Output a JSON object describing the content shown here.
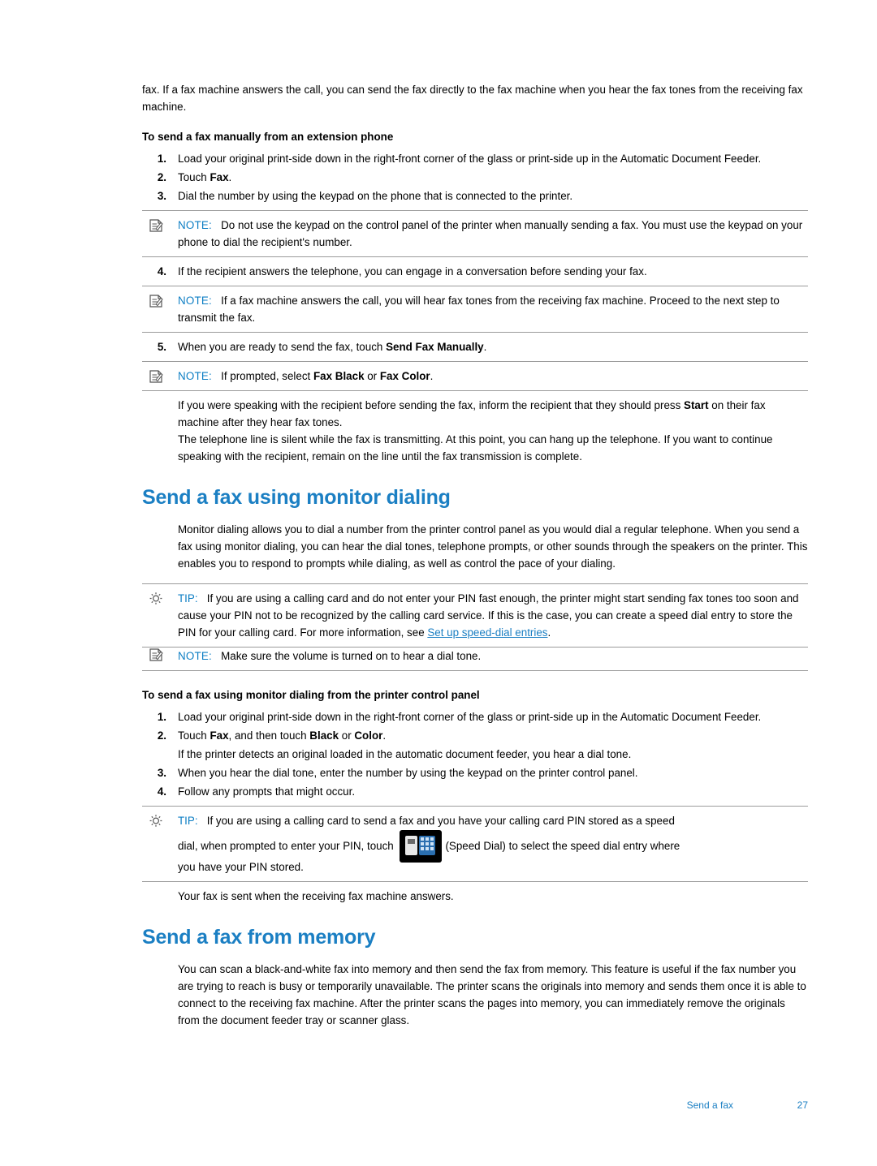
{
  "intro": {
    "line": "fax. If a fax machine answers the call, you can send the fax directly to the fax machine when you hear the fax tones from the receiving fax machine."
  },
  "section1": {
    "heading": "To send a fax manually from an extension phone",
    "steps": [
      {
        "num": "1.",
        "text": "Load your original print-side down in the right-front corner of the glass or print-side up in the Automatic Document Feeder."
      },
      {
        "num": "2.",
        "pre": "Touch ",
        "bold": "Fax",
        "post": "."
      },
      {
        "num": "3.",
        "text": "Dial the number by using the keypad on the phone that is connected to the printer."
      },
      {
        "num": "4.",
        "text": "If the recipient answers the telephone, you can engage in a conversation before sending your fax."
      },
      {
        "num": "5.",
        "pre": "When you are ready to send the fax, touch ",
        "bold": "Send Fax Manually",
        "post": "."
      }
    ],
    "note1": {
      "label": "NOTE:",
      "text": "Do not use the keypad on the control panel of the printer when manually sending a fax. You must use the keypad on your phone to dial the recipient's number."
    },
    "note2": {
      "label": "NOTE:",
      "text": "If a fax machine answers the call, you will hear fax tones from the receiving fax machine. Proceed to the next step to transmit the fax."
    },
    "note3": {
      "label": "NOTE:",
      "pre": "If prompted, select ",
      "bold1": "Fax Black",
      "mid": " or ",
      "bold2": "Fax Color",
      "post": "."
    },
    "after1_pre": "If you were speaking with the recipient before sending the fax, inform the recipient that they should press ",
    "after1_bold": "Start",
    "after1_post": " on their fax machine after they hear fax tones.",
    "after2": "The telephone line is silent while the fax is transmitting. At this point, you can hang up the telephone. If you want to continue speaking with the recipient, remain on the line until the fax transmission is complete."
  },
  "section2": {
    "heading": "Send a fax using monitor dialing",
    "intro": "Monitor dialing allows you to dial a number from the printer control panel as you would dial a regular telephone. When you send a fax using monitor dialing, you can hear the dial tones, telephone prompts, or other sounds through the speakers on the printer. This enables you to respond to prompts while dialing, as well as control the pace of your dialing.",
    "tip1": {
      "label": "TIP:",
      "text_pre": "If you are using a calling card and do not enter your PIN fast enough, the printer might start sending fax tones too soon and cause your PIN not to be recognized by the calling card service. If this is the case, you can create a speed dial entry to store the PIN for your calling card. For more information, see ",
      "link": "Set up speed-dial entries",
      "text_post": "."
    },
    "note1": {
      "label": "NOTE:",
      "text": "Make sure the volume is turned on to hear a dial tone."
    },
    "sub_heading": "To send a fax using monitor dialing from the printer control panel",
    "steps": [
      {
        "num": "1.",
        "text": "Load your original print-side down in the right-front corner of the glass or print-side up in the Automatic Document Feeder."
      },
      {
        "num": "2.",
        "pre": "Touch ",
        "bold1": "Fax",
        "mid": ", and then touch ",
        "bold2": "Black",
        "mid2": " or ",
        "bold3": "Color",
        "post": "."
      },
      {
        "num": "3.",
        "text": "When you hear the dial tone, enter the number by using the keypad on the printer control panel."
      },
      {
        "num": "4.",
        "text": "Follow any prompts that might occur."
      }
    ],
    "step2_extra": "If the printer detects an original loaded in the automatic document feeder, you hear a dial tone.",
    "tip2": {
      "label": "TIP:",
      "line1": "If you are using a calling card to send a fax and you have your calling card PIN stored as a speed",
      "line2_pre": "dial, when prompted to enter your PIN, touch ",
      "icon_name": "speed-dial-button",
      "line2_post": "(Speed Dial) to select the speed dial entry where",
      "line3": "you have your PIN stored."
    },
    "closing": "Your fax is sent when the receiving fax machine answers."
  },
  "section3": {
    "heading": "Send a fax from memory",
    "body": "You can scan a black-and-white fax into memory and then send the fax from memory. This feature is useful if the fax number you are trying to reach is busy or temporarily unavailable. The printer scans the originals into memory and sends them once it is able to connect to the receiving fax machine. After the printer scans the pages into memory, you can immediately remove the originals from the document feeder tray or scanner glass."
  },
  "footer": {
    "label": "Send a fax",
    "page": "27"
  },
  "colors": {
    "heading": "#1b7fc3",
    "label": "#0d7ec4",
    "rule": "#9b9b9b"
  }
}
